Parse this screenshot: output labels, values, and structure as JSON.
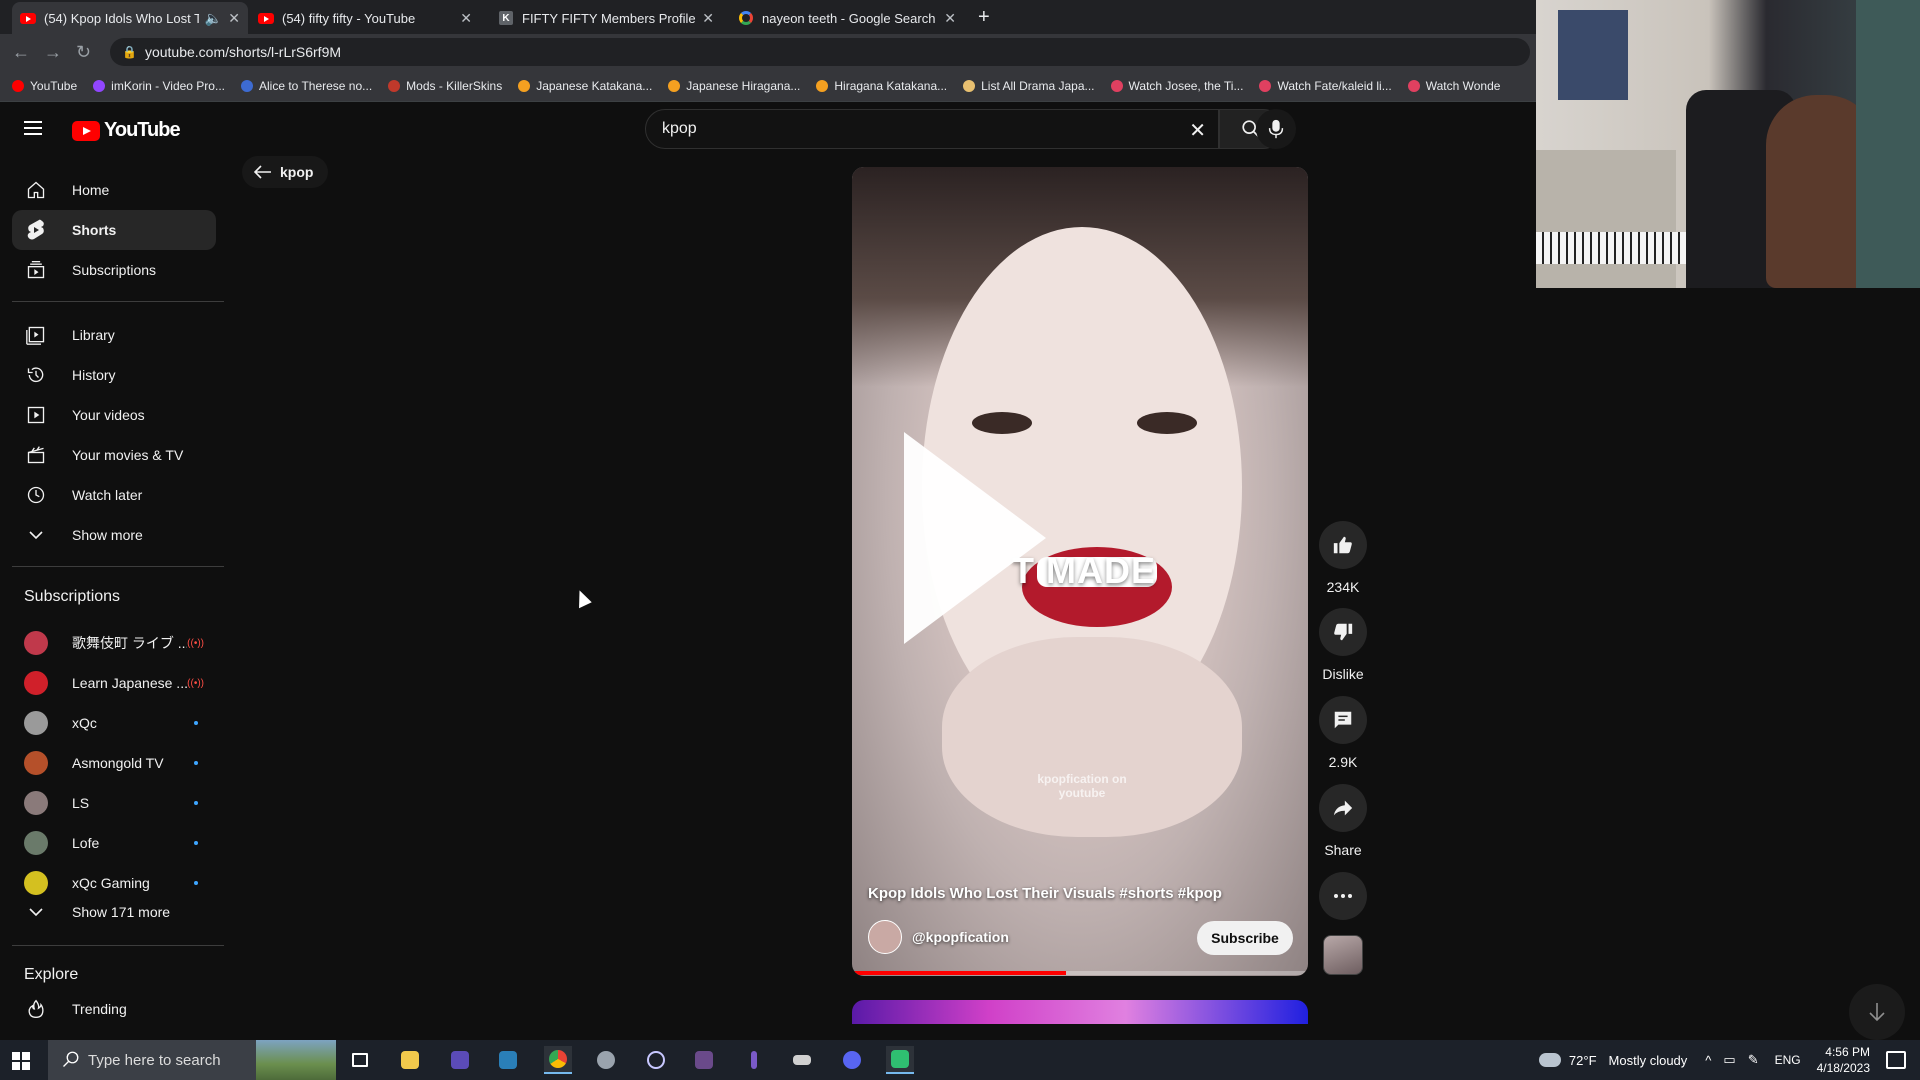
{
  "browser": {
    "tabs": [
      {
        "title": "(54) Kpop Idols Who Lost Th",
        "favicon": "youtube-icon",
        "active": true,
        "audio": true
      },
      {
        "title": "(54) fifty fifty - YouTube",
        "favicon": "youtube-icon",
        "active": false
      },
      {
        "title": "FIFTY FIFTY Members Profile (Up",
        "favicon": "kprofiles-icon",
        "active": false
      },
      {
        "title": "nayeon teeth - Google Search",
        "favicon": "google-icon",
        "active": false
      }
    ],
    "url": "youtube.com/shorts/l-rLrS6rf9M",
    "bookmarks": [
      {
        "label": "YouTube",
        "color": "#ff0000"
      },
      {
        "label": "imKorin - Video Pro...",
        "color": "#9146ff"
      },
      {
        "label": "Alice to Therese no...",
        "color": "#3d6bd1"
      },
      {
        "label": "Mods - KillerSkins",
        "color": "#c0392b"
      },
      {
        "label": "Japanese Katakana...",
        "color": "#f4a020"
      },
      {
        "label": "Japanese Hiragana...",
        "color": "#f4a020"
      },
      {
        "label": "Hiragana Katakana...",
        "color": "#f4a020"
      },
      {
        "label": "List All Drama Japa...",
        "color": "#e8c070"
      },
      {
        "label": "Watch Josee, the Ti...",
        "color": "#e04060"
      },
      {
        "label": "Watch Fate/kaleid li...",
        "color": "#e04060"
      },
      {
        "label": "Watch Wonde",
        "color": "#e04060"
      }
    ]
  },
  "masthead": {
    "logo_text": "YouTube",
    "search_value": "kpop"
  },
  "back_chip": {
    "label": "kpop"
  },
  "sidebar": {
    "primary": [
      {
        "label": "Home",
        "icon": "home-icon"
      },
      {
        "label": "Shorts",
        "icon": "shorts-icon",
        "active": true
      },
      {
        "label": "Subscriptions",
        "icon": "subscriptions-icon"
      }
    ],
    "library": [
      {
        "label": "Library",
        "icon": "library-icon"
      },
      {
        "label": "History",
        "icon": "history-icon"
      },
      {
        "label": "Your videos",
        "icon": "your-videos-icon"
      },
      {
        "label": "Your movies & TV",
        "icon": "movies-icon"
      },
      {
        "label": "Watch later",
        "icon": "watch-later-icon"
      },
      {
        "label": "Show more",
        "icon": "chevron-down-icon"
      }
    ],
    "subscriptions_heading": "Subscriptions",
    "subscriptions": [
      {
        "label": "歌舞伎町 ライブ ...",
        "status": "live",
        "color": "#c0394b"
      },
      {
        "label": "Learn Japanese ...",
        "status": "live",
        "color": "#d0202a"
      },
      {
        "label": "xQc",
        "status": "new",
        "color": "#9a9a9a"
      },
      {
        "label": "Asmongold TV",
        "status": "new",
        "color": "#b5502a"
      },
      {
        "label": "LS",
        "status": "new",
        "color": "#8a7a7a"
      },
      {
        "label": "Lofe",
        "status": "new",
        "color": "#6a7a6a"
      },
      {
        "label": "xQc Gaming",
        "status": "new",
        "color": "#d4c020"
      }
    ],
    "show_more_subs": "Show 171 more",
    "explore_heading": "Explore",
    "explore": [
      {
        "label": "Trending",
        "icon": "trending-icon"
      }
    ]
  },
  "short": {
    "caption_overlay": "T MADE",
    "watermark": "kpopfication on youtube",
    "title": "Kpop Idols Who Lost Their Visuals #shorts #kpop",
    "channel": "@kpopfication",
    "subscribe_label": "Subscribe",
    "progress": 0.47
  },
  "actions": {
    "like_count": "234K",
    "dislike_label": "Dislike",
    "comment_count": "2.9K",
    "share_label": "Share"
  },
  "taskbar": {
    "search_placeholder": "Type here to search",
    "weather_temp": "72°F",
    "weather_desc": "Mostly cloudy",
    "language": "ENG",
    "time": "4:56 PM",
    "date": "4/18/2023"
  }
}
